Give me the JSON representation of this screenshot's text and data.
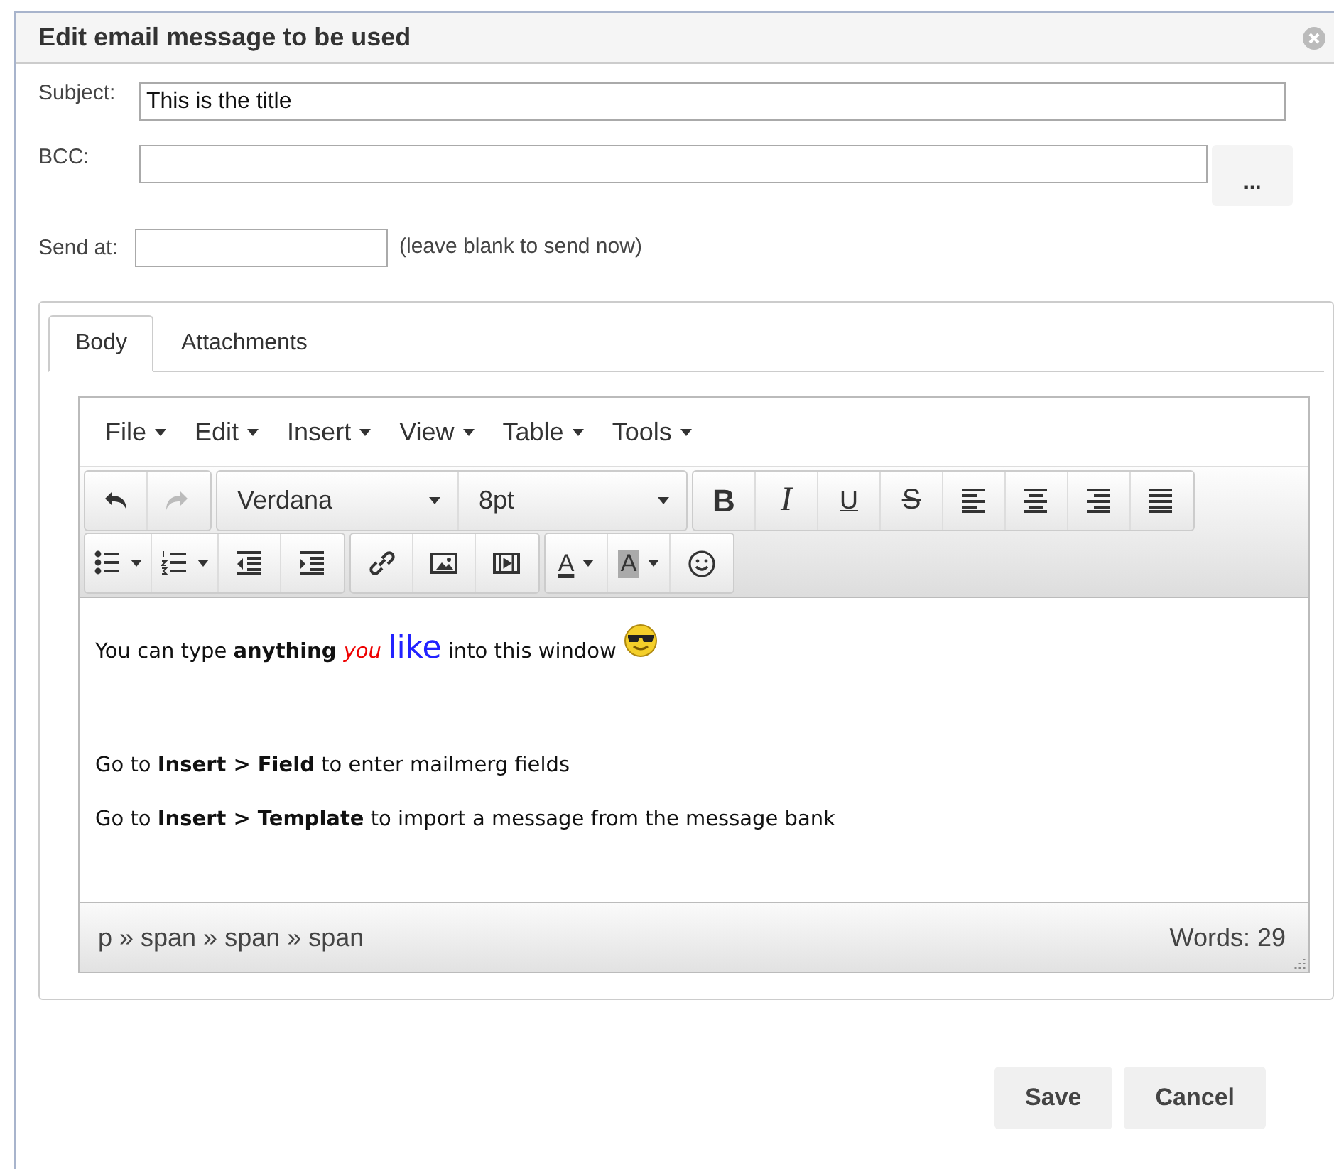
{
  "dialog": {
    "title": "Edit email message to be used"
  },
  "form": {
    "subject": {
      "label": "Subject:",
      "value": "This is the title"
    },
    "bcc": {
      "label": "BCC:",
      "button": "..."
    },
    "send_at": {
      "label": "Send at:",
      "hint": "(leave blank to send now)"
    }
  },
  "tabs": [
    {
      "label": "Body",
      "selected": true
    },
    {
      "label": "Attachments",
      "selected": false
    }
  ],
  "editor": {
    "menus": [
      "File",
      "Edit",
      "Insert",
      "View",
      "Table",
      "Tools"
    ],
    "toolbar": [
      [
        {
          "kind": "undo",
          "disabled": false
        },
        {
          "kind": "redo",
          "disabled": true
        }
      ],
      [
        {
          "kind": "font",
          "value": "Verdana"
        },
        {
          "kind": "size",
          "value": "8pt"
        }
      ],
      [
        {
          "kind": "bold",
          "glyph": "B"
        },
        {
          "kind": "italic",
          "glyph": "I"
        },
        {
          "kind": "underline",
          "glyph": "U"
        },
        {
          "kind": "strike",
          "glyph": "S"
        },
        {
          "kind": "align-left"
        },
        {
          "kind": "align-center"
        },
        {
          "kind": "align-right"
        },
        {
          "kind": "justify"
        }
      ],
      [
        {
          "kind": "bullets"
        },
        {
          "kind": "numbers"
        },
        {
          "kind": "outdent"
        },
        {
          "kind": "indent"
        }
      ],
      [
        {
          "kind": "link"
        },
        {
          "kind": "image"
        },
        {
          "kind": "media"
        }
      ],
      [
        {
          "kind": "text-color",
          "glyph": "A"
        },
        {
          "kind": "back-color",
          "glyph": "A"
        },
        {
          "kind": "emoji"
        }
      ]
    ],
    "paragraphs": [
      {
        "runs": [
          {
            "kind": "plain",
            "text": "You can type "
          },
          {
            "kind": "bold",
            "text": "anything "
          },
          {
            "kind": "red-italic",
            "text": "you "
          },
          {
            "kind": "blue-large",
            "text": "like"
          },
          {
            "kind": "plain",
            "text": " into this window"
          }
        ],
        "emoji": true
      },
      {
        "runs": [
          {
            "kind": "plain",
            "text": "Go to "
          },
          {
            "kind": "bold",
            "text": "Insert > Field"
          },
          {
            "kind": "plain",
            "text": " to enter mailmerg fields"
          }
        ]
      },
      {
        "runs": [
          {
            "kind": "plain",
            "text": "Go to "
          },
          {
            "kind": "bold",
            "text": "Insert > Template"
          },
          {
            "kind": "plain",
            "text": " to import a message from the message bank"
          }
        ]
      }
    ],
    "path": "p » span » span » span",
    "word_count": "Words: 29"
  },
  "buttons": [
    "Save",
    "Cancel"
  ]
}
